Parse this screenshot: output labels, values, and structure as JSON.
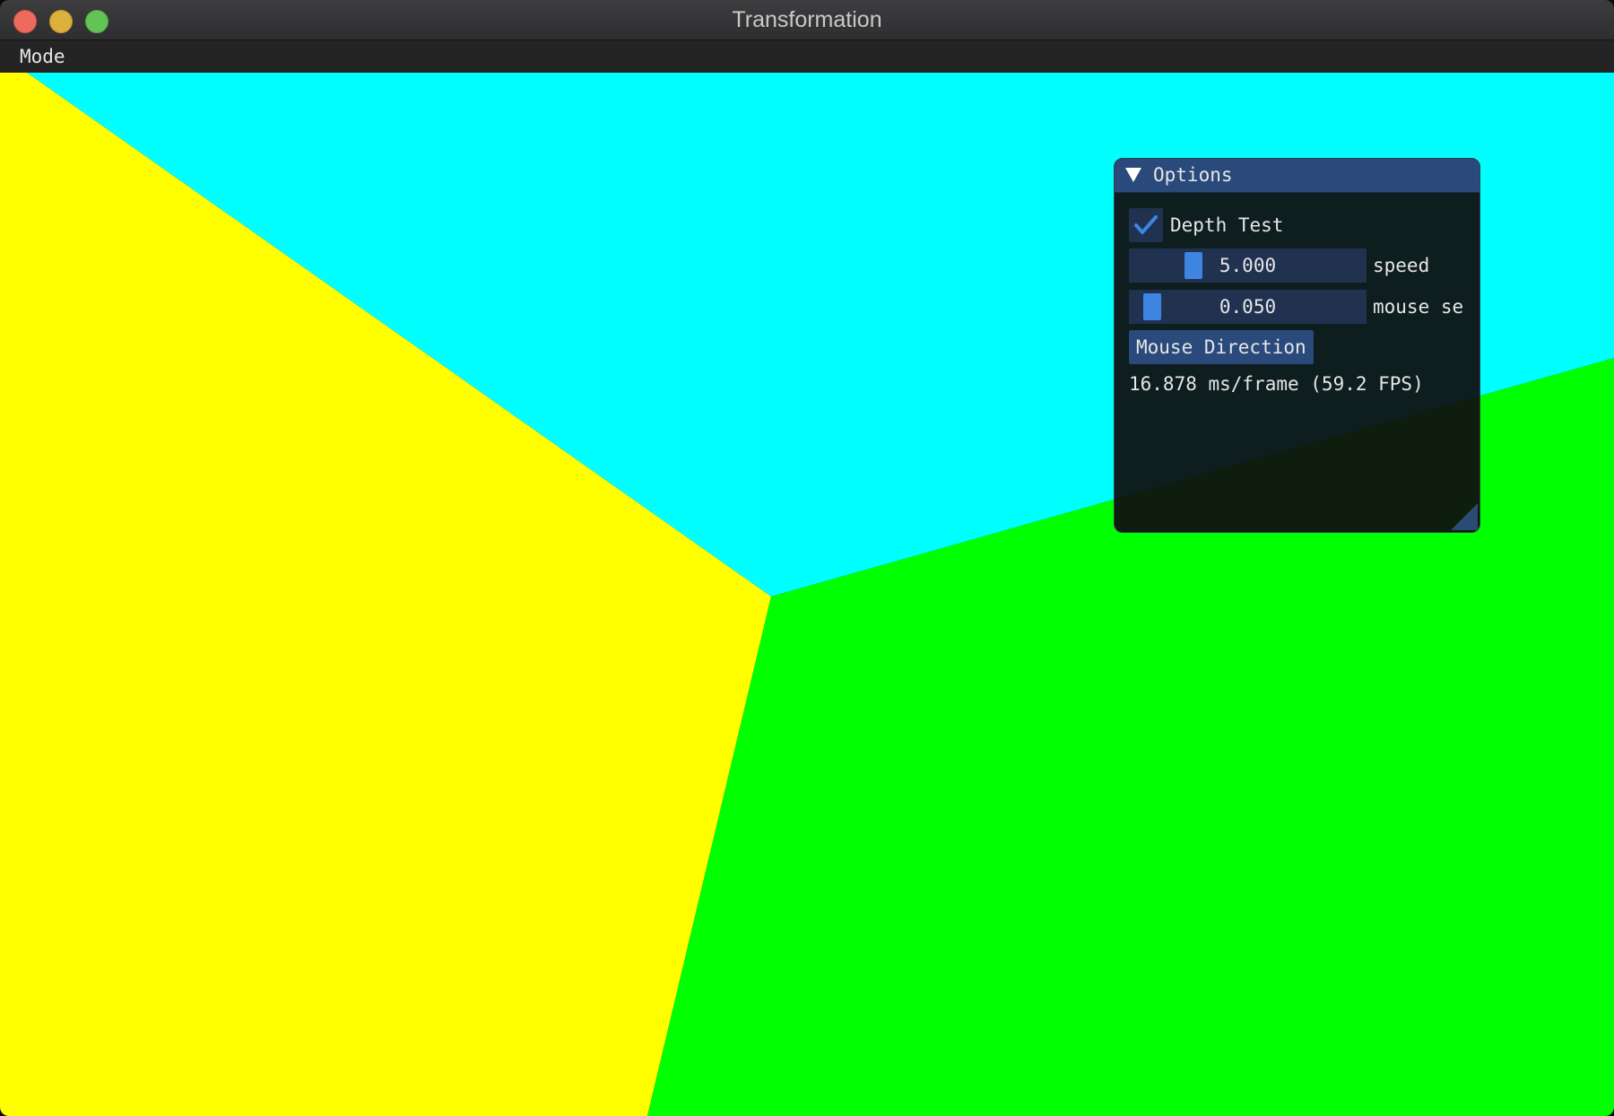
{
  "window": {
    "title": "Transformation"
  },
  "menubar": {
    "items": [
      {
        "label": "Mode"
      }
    ]
  },
  "scene": {
    "colors": {
      "top_face": "#00ffff",
      "left_face": "#ffff00",
      "right_face": "#00ff00"
    }
  },
  "options_panel": {
    "title": "Options",
    "collapse_icon": "triangle-down-icon",
    "depth_test": {
      "label": "Depth Test",
      "checked": true,
      "check_icon": "checkmark-icon"
    },
    "speed_slider": {
      "value": "5.000",
      "label": "speed"
    },
    "mouse_sensitivity_slider": {
      "value": "0.050",
      "label": "mouse se"
    },
    "mouse_direction_button": {
      "label": "Mouse Direction"
    },
    "fps_text": "16.878 ms/frame (59.2 FPS)"
  },
  "theme": {
    "accent": "#3d85e0",
    "frame_bg": "#203250",
    "header_bg": "#294a7a"
  }
}
